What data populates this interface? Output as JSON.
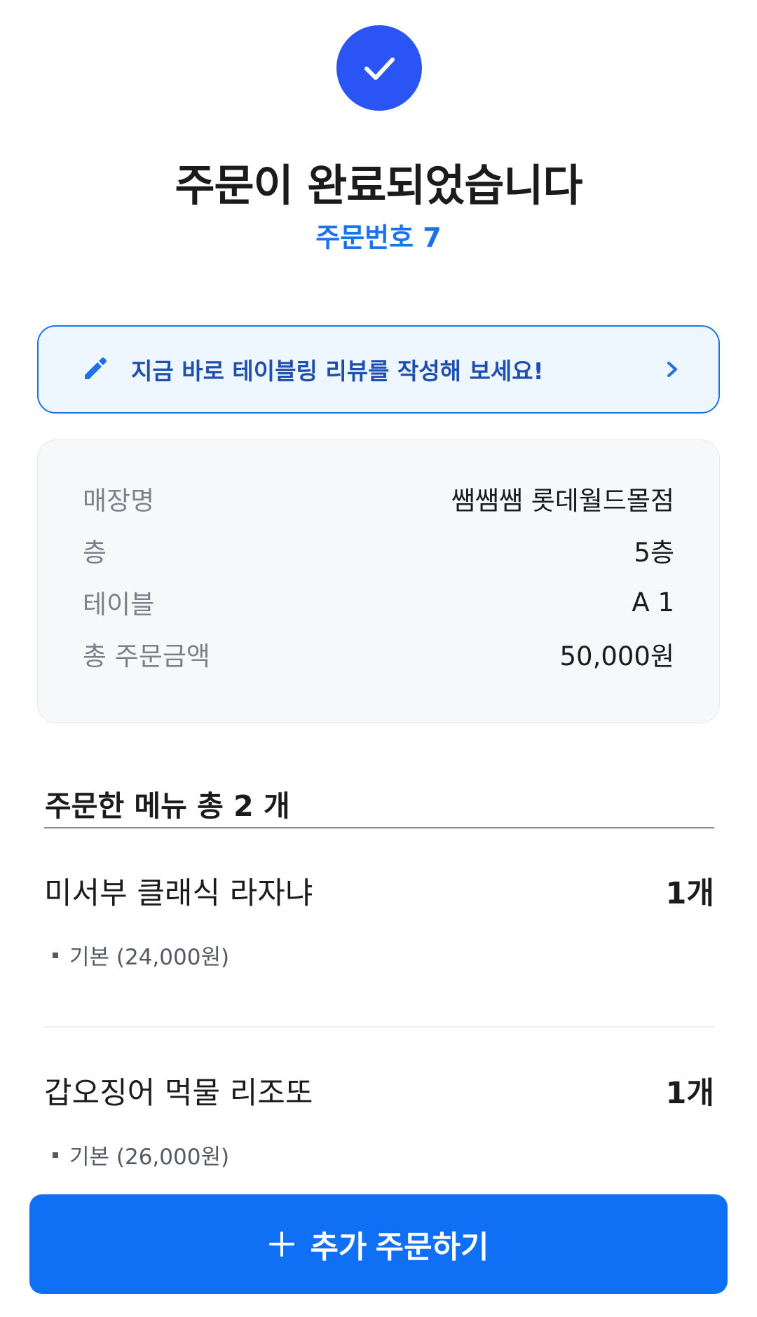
{
  "header": {
    "title": "주문이 완료되었습니다",
    "order_number": "주문번호 7"
  },
  "review_banner": {
    "text": "지금 바로 테이블링 리뷰를 작성해 보세요!",
    "icon": "pencil-icon",
    "chevron_icon": "chevron-right-icon"
  },
  "order_info": [
    {
      "label": "매장명",
      "value": "쌤쌤쌤 롯데월드몰점"
    },
    {
      "label": "층",
      "value": "5층"
    },
    {
      "label": "테이블",
      "value": "A 1"
    },
    {
      "label": "총 주문금액",
      "value": "50,000원"
    }
  ],
  "menu_section": {
    "title": "주문한 메뉴 총 2 개",
    "items": [
      {
        "name": "미서부 클래식 라자냐",
        "quantity": "1개",
        "option": "기본 (24,000원)"
      },
      {
        "name": "갑오징어 먹물 리조또",
        "quantity": "1개",
        "option": "기본 (26,000원)"
      }
    ]
  },
  "footer": {
    "add_order_label": "추가 주문하기",
    "icon": "plus-icon"
  },
  "colors": {
    "accent": "#1a73e8",
    "check_circle": "#2b54f5",
    "button": "#0f6ff5",
    "banner_bg": "#eef6ff",
    "card_bg": "#f7f8fa"
  }
}
